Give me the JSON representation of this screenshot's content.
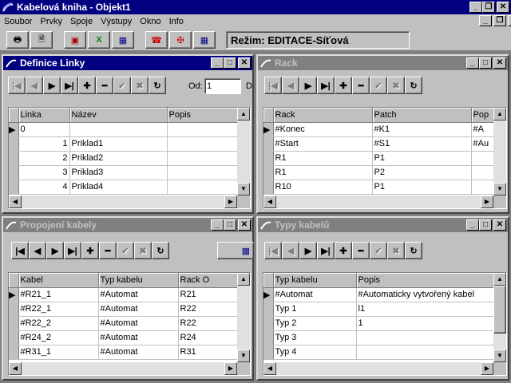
{
  "app": {
    "title": "Kabelová kniha - Objekt1"
  },
  "menu": {
    "items": [
      "Soubor",
      "Prvky",
      "Spoje",
      "Výstupy",
      "Okno",
      "Info"
    ]
  },
  "toolbar": {
    "mode_label": "Režim: EDITACE-Síťová"
  },
  "windows": {
    "definice": {
      "title": "Definice Linky",
      "od_label": "Od:",
      "od_value": "1",
      "trailing": "D",
      "columns": [
        "Linka",
        "Název",
        "Popis"
      ],
      "rows": [
        [
          "0",
          "",
          ""
        ],
        [
          "1",
          "Priklad1",
          ""
        ],
        [
          "2",
          "Priklad2",
          ""
        ],
        [
          "3",
          "Priklad3",
          ""
        ],
        [
          "4",
          "Priklad4",
          ""
        ]
      ]
    },
    "rack": {
      "title": "Rack",
      "columns": [
        "Rack",
        "Patch",
        "Pop"
      ],
      "rows": [
        [
          "#Konec",
          "#K1",
          "#A"
        ],
        [
          "#Start",
          "#S1",
          "#Au"
        ],
        [
          "R1",
          "P1",
          ""
        ],
        [
          "R1",
          "P2",
          ""
        ],
        [
          "R10",
          "P1",
          ""
        ]
      ]
    },
    "propojeni": {
      "title": "Propojení kabely",
      "columns": [
        "Kabel",
        "Typ kabelu",
        "Rack O"
      ],
      "rows": [
        [
          "#R21_1",
          "#Automat",
          "R21"
        ],
        [
          "#R22_1",
          "#Automat",
          "R22"
        ],
        [
          "#R22_2",
          "#Automat",
          "R22"
        ],
        [
          "#R24_2",
          "#Automat",
          "R24"
        ],
        [
          "#R31_1",
          "#Automat",
          "R31"
        ]
      ]
    },
    "typy": {
      "title": "Typy kabelů",
      "columns": [
        "Typ kabelu",
        "Popis"
      ],
      "rows": [
        [
          "#Automat",
          "#Automaticky vytvořený kabel"
        ],
        [
          "Typ 1",
          "l1"
        ],
        [
          "Typ 2",
          "1"
        ],
        [
          "Typ 3",
          ""
        ],
        [
          "Typ 4",
          ""
        ]
      ]
    }
  },
  "colors": {
    "active_title": "#000080",
    "inactive_title": "#808080",
    "face": "#c0c0c0"
  }
}
